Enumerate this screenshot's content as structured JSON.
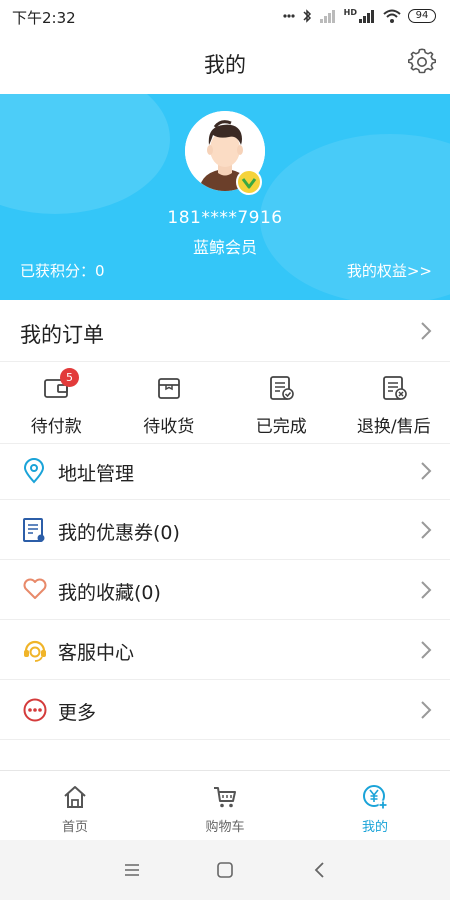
{
  "status_bar": {
    "time": "下午2:32",
    "network_label": "HD",
    "battery": "94"
  },
  "header": {
    "title": "我的"
  },
  "profile": {
    "phone": "181****7916",
    "member_level": "蓝鲸会员",
    "points_label": "已获积分：0",
    "rights_link": "我的权益>>",
    "accent_color": "#34c6f8"
  },
  "orders": {
    "title": "我的订单",
    "items": [
      {
        "label": "待付款",
        "icon": "wallet-icon",
        "badge": "5"
      },
      {
        "label": "待收货",
        "icon": "box-icon"
      },
      {
        "label": "已完成",
        "icon": "completed-doc-icon"
      },
      {
        "label": "退换/售后",
        "icon": "return-doc-icon"
      }
    ]
  },
  "menu": [
    {
      "label": "地址管理",
      "icon": "location-pin-icon"
    },
    {
      "label": "我的优惠券(0)",
      "icon": "coupon-icon"
    },
    {
      "label": "我的收藏(0)",
      "icon": "heart-icon"
    },
    {
      "label": "客服中心",
      "icon": "headset-icon"
    },
    {
      "label": "更多",
      "icon": "more-dots-icon"
    }
  ],
  "bottom_nav": [
    {
      "label": "首页",
      "icon": "home-icon",
      "active": false
    },
    {
      "label": "购物车",
      "icon": "cart-icon",
      "active": false
    },
    {
      "label": "我的",
      "icon": "yen-plus-icon",
      "active": true
    }
  ],
  "colors": {
    "active_tab": "#1aa3d8",
    "badge": "#e23b3b"
  }
}
